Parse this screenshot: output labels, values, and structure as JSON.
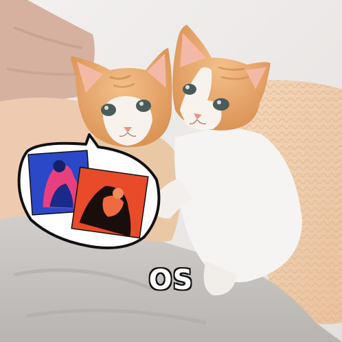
{
  "caption": {
    "text": "OS"
  },
  "colors": {
    "wall": "#ece8e6",
    "blanket_pink": "#d9b6a6",
    "knit": "#f0cfae",
    "gray_blanket": "#c9c5c3",
    "fur_orange": "#e6a66a",
    "fur_white": "#f6f4f2",
    "photo_blue": "#2b48c8",
    "photo_pink": "#e8407e",
    "photo_red": "#e84a2a",
    "caption_fill": "#ffffff",
    "caption_stroke": "#111111"
  },
  "icons": [
    "speech-bubble",
    "kitten-left",
    "kitten-right"
  ]
}
